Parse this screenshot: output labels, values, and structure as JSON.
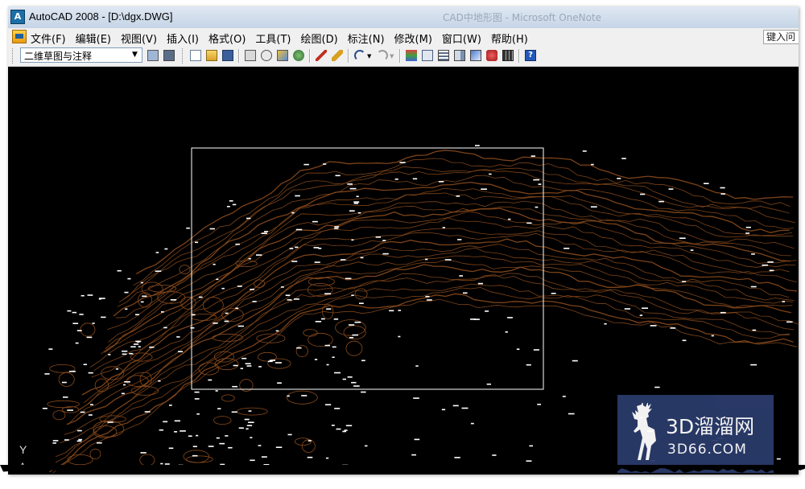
{
  "window": {
    "title": "AutoCAD 2008 - [D:\\dgx.DWG]",
    "ghost_title": "CAD中地形图 - Microsoft OneNote"
  },
  "menu": {
    "items": [
      "文件(F)",
      "编辑(E)",
      "视图(V)",
      "插入(I)",
      "格式(O)",
      "工具(T)",
      "绘图(D)",
      "标注(N)",
      "修改(M)",
      "窗口(W)",
      "帮助(H)"
    ],
    "help_input": "键入问"
  },
  "toolbar": {
    "workspace": "二维草图与注释",
    "buttons": [
      "new-icon",
      "open-icon",
      "save-icon",
      "plot-icon",
      "plot-preview-icon",
      "publish-icon",
      "3d-dwf-icon",
      "cut-icon",
      "match-properties-icon",
      "undo-icon",
      "redo-icon",
      "layer-icon",
      "properties-icon",
      "design-center-icon",
      "tool-palettes-icon",
      "markup-icon",
      "quickcalc-icon",
      "help-icon"
    ]
  },
  "drawing": {
    "ucs_y": "Y",
    "ucs_a": "A",
    "background": "#000000",
    "contour_color": "#8a4a1c",
    "selection_window_color": "#ffffff"
  },
  "watermark": {
    "cn": "3D溜溜网",
    "en": "3D66.COM",
    "bg": "#2b3b6b"
  }
}
